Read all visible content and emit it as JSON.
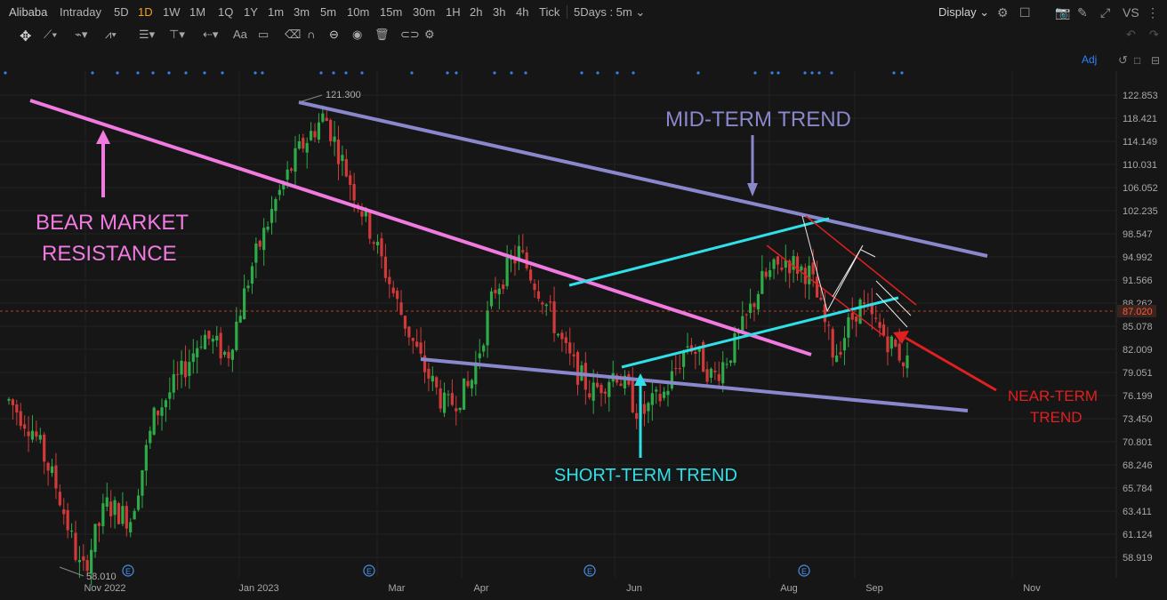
{
  "toolbar": {
    "symbol": "Alibaba",
    "timeframes": [
      "Intraday",
      "5D",
      "1D",
      "1W",
      "1M",
      "1Q",
      "1Y",
      "1m",
      "3m",
      "5m",
      "10m",
      "15m",
      "30m",
      "1H",
      "2h",
      "3h",
      "4h",
      "Tick"
    ],
    "active_timeframe": "1D",
    "range_select": "5Days : 5m",
    "display_label": "Display",
    "vs_label": "VS"
  },
  "chart": {
    "adj_label": "Adj",
    "current_price": "87.020",
    "high_label": "121.300",
    "low_label": "58.010",
    "y_ticks": [
      "122.853",
      "118.421",
      "114.149",
      "110.031",
      "106.052",
      "102.235",
      "98.547",
      "94.992",
      "91.566",
      "88.262",
      "85.078",
      "82.009",
      "79.051",
      "76.199",
      "73.450",
      "70.801",
      "68.246",
      "65.784",
      "63.411",
      "61.124",
      "58.919"
    ],
    "x_ticks": [
      "Nov 2022",
      "Jan 2023",
      "Mar",
      "Apr",
      "Jun",
      "Aug",
      "Sep",
      "Nov"
    ],
    "event_marker": "E",
    "annotations": {
      "bear_line1": "BEAR MARKET",
      "bear_line2": "RESISTANCE",
      "mid": "MID-TERM TREND",
      "short": "SHORT-TERM TREND",
      "near1": "NEAR-TERM",
      "near2": "TREND"
    },
    "colors": {
      "bg": "#161616",
      "up": "#2eaa48",
      "down": "#d23a3a",
      "bear_line": "#f07ae0",
      "mid_line": "#8a88cc",
      "short_line": "#2fe0e8",
      "near_line": "#e02020",
      "price_tag": "#e04a2a",
      "accent": "#f0a020"
    }
  },
  "chart_data": {
    "type": "candlestick",
    "symbol": "Alibaba",
    "interval": "1D",
    "price_range": [
      57.5,
      125.0
    ],
    "last_price": 87.02,
    "period_high": 121.3,
    "period_low": 58.01,
    "series": [
      {
        "name": "price_path",
        "points": [
          [
            "Oct 2022",
            82
          ],
          [
            "Oct 2022",
            78
          ],
          [
            "Oct 2022",
            70
          ],
          [
            "Nov 2022",
            58.5
          ],
          [
            "Nov 2022",
            68
          ],
          [
            "Nov 2022",
            66
          ],
          [
            "Dec 2022",
            80
          ],
          [
            "Dec 2022",
            85
          ],
          [
            "Dec 2022",
            91
          ],
          [
            "Dec 2022",
            88
          ],
          [
            "Jan 2023",
            100
          ],
          [
            "Jan 2023",
            109
          ],
          [
            "Jan 2023",
            116
          ],
          [
            "Jan 2023",
            120.5
          ],
          [
            "Feb 2023",
            112
          ],
          [
            "Feb 2023",
            104
          ],
          [
            "Feb 2023",
            95
          ],
          [
            "Mar",
            87
          ],
          [
            "Mar",
            81
          ],
          [
            "Mar",
            84
          ],
          [
            "Mar",
            97
          ],
          [
            "Apr",
            102
          ],
          [
            "Apr",
            96
          ],
          [
            "Apr",
            88
          ],
          [
            "May",
            83
          ],
          [
            "May",
            86
          ],
          [
            "May",
            80
          ],
          [
            "Jun",
            83
          ],
          [
            "Jun",
            90
          ],
          [
            "Jun",
            85
          ],
          [
            "Jul",
            90
          ],
          [
            "Jul",
            98
          ],
          [
            "Jul",
            101
          ],
          [
            "Aug",
            99
          ],
          [
            "Aug",
            88
          ],
          [
            "Aug",
            95
          ],
          [
            "Sep",
            91
          ],
          [
            "Sep",
            87.02
          ]
        ]
      }
    ],
    "trend_lines": [
      {
        "name": "BEAR MARKET RESISTANCE",
        "from": [
          "Oct 2022",
          117.5
        ],
        "to": [
          "Aug",
          82
        ]
      },
      {
        "name": "MID-TERM TREND",
        "from": [
          "Feb 2023",
          121.3
        ],
        "to": [
          "Oct",
          95
        ]
      },
      {
        "name": "MID-TERM TREND",
        "from": [
          "Mar",
          81
        ],
        "to": [
          "Oct",
          74
        ]
      },
      {
        "name": "SHORT-TERM TREND",
        "from": [
          "May",
          91
        ],
        "to": [
          "Aug",
          101.5
        ]
      },
      {
        "name": "SHORT-TERM TREND",
        "from": [
          "Jun",
          79.8
        ],
        "to": [
          "Sep",
          88.5
        ]
      },
      {
        "name": "NEAR-TERM TREND",
        "from": [
          "Jul",
          102
        ],
        "to": [
          "Sep",
          88
        ]
      },
      {
        "name": "NEAR-TERM TREND",
        "from": [
          "Jul",
          98
        ],
        "to": [
          "Sep",
          83
        ]
      }
    ]
  }
}
